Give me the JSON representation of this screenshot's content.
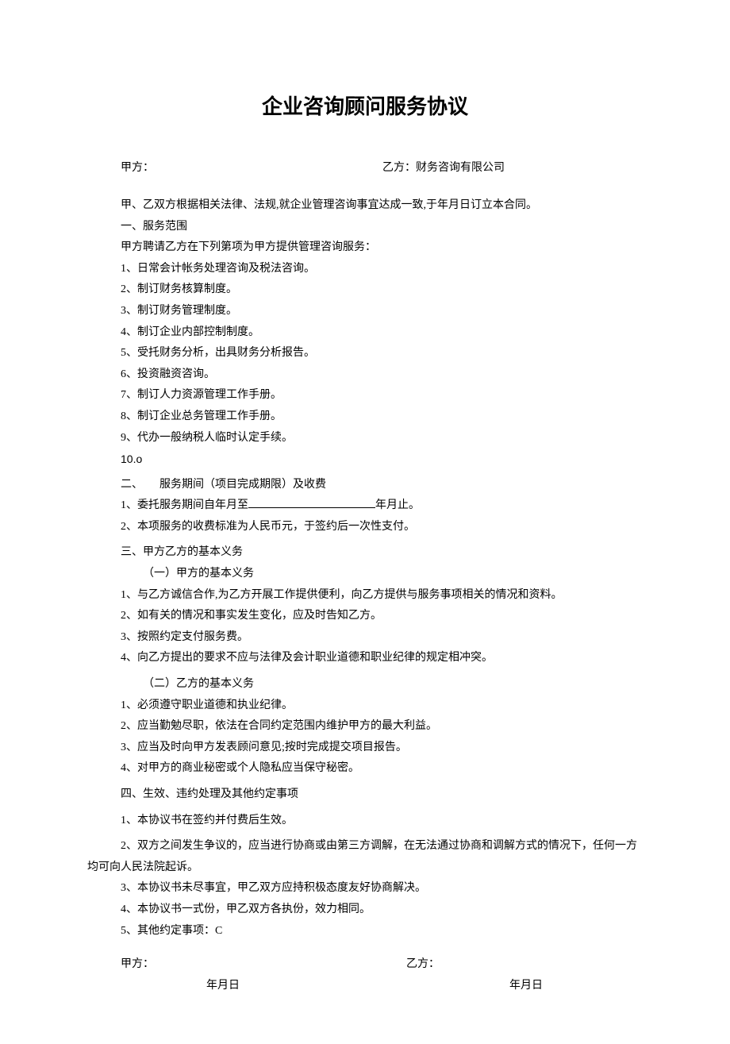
{
  "title": "企业咨询顾问服务协议",
  "partyA_label": "甲方：",
  "partyB_label": "乙方：财务咨询有限公司",
  "preamble": "甲、乙双方根据相关法律、法规,就企业管理咨询事宜达成一致,于年月日订立本合同。",
  "s1": {
    "heading": "一、服务范围",
    "intro": "甲方聘请乙方在下列第项为甲方提供管理咨询服务：",
    "items": [
      "1、日常会计帐务处理咨询及税法咨询。",
      "2、制订财务核算制度。",
      "3、制订财务管理制度。",
      "4、制订企业内部控制制度。",
      "5、受托财务分析，出具财务分析报告。",
      "6、投资融资咨询。",
      "7、制订人力资源管理工作手册。",
      "8、制订企业总务管理工作手册。",
      "9、代办一般纳税人临时认定手续。",
      "10.o"
    ]
  },
  "s2": {
    "heading": "二、　　服务期间（项目完成期限）及收费",
    "item1_pre": "1、委托服务期间自年月至",
    "item1_post": "年月止。",
    "item2": "2、本项服务的收费标准为人民币元，于签约后一次性支付。"
  },
  "s3": {
    "heading": "三、甲方乙方的基本义务",
    "sub1": "（一）甲方的基本义务",
    "sub1_items": [
      "1、与乙方诚信合作,为乙方开展工作提供便利，向乙方提供与服务事项相关的情况和资料。",
      "2、如有关的情况和事实发生变化，应及时告知乙方。",
      "3、按照约定支付服务费。",
      "4、向乙方提出的要求不应与法律及会计职业道德和职业纪律的规定相冲突。"
    ],
    "sub2": "（二）乙方的基本义务",
    "sub2_items": [
      "1、必须遵守职业道德和执业纪律。",
      "2、应当勤勉尽职，依法在合同约定范围内维护甲方的最大利益。",
      "3、应当及时向甲方发表顾问意见;按时完成提交项目报告。",
      "4、对甲方的商业秘密或个人隐私应当保守秘密。"
    ]
  },
  "s4": {
    "heading": "四、生效、违约处理及其他约定事项",
    "items": [
      "1、本协议书在签约并付费后生效。",
      "2、双方之间发生争议的，应当进行协商或由第三方调解，在无法通过协商和调解方式的情况下，任何一方均可向人民法院起诉。",
      "3、本协议书未尽事宜，甲乙双方应持积极态度友好协商解决。",
      "4、本协议书一式份，甲乙双方各执份，效力相同。",
      "5、其他约定事项：C"
    ]
  },
  "signA": "甲方：",
  "signB": "乙方：",
  "dateA": "年月日",
  "dateB": "年月日"
}
